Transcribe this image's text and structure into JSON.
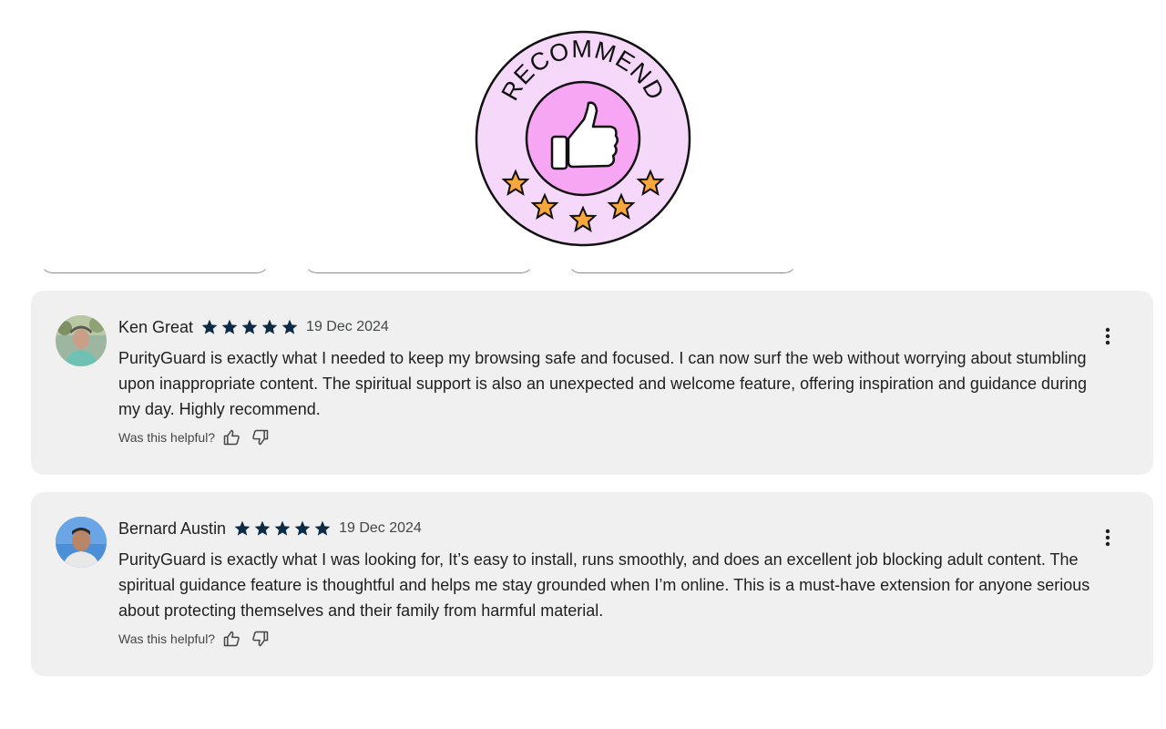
{
  "badge": {
    "text": "RECOMMEND",
    "icon": "thumbs-up-icon",
    "star_count": 5,
    "colors": {
      "outer_fill": "#f6d8fb",
      "inner_fill": "#f7a6f3",
      "star_fill": "#f8a73c",
      "outline": "#111111"
    }
  },
  "reviews": [
    {
      "name": "Ken Great",
      "rating": 5,
      "date": "19 Dec 2024",
      "text": "PurityGuard is exactly what I needed to keep my browsing safe and focused. I can now surf the web without worrying about stumbling upon inappropriate content. The spiritual support is also an unexpected and welcome feature, offering inspiration and guidance during my day. Highly recommend.",
      "helpful_label": "Was this helpful?"
    },
    {
      "name": "Bernard Austin",
      "rating": 5,
      "date": "19 Dec 2024",
      "text": "PurityGuard is exactly what I was looking for, It’s easy to install, runs smoothly, and does an excellent job blocking adult content. The spiritual guidance feature is thoughtful and helps me stay grounded when I’m online. This is a must-have extension for anyone serious about protecting themselves and their family from harmful material.",
      "helpful_label": "Was this helpful?"
    }
  ],
  "colors": {
    "card_bg": "#eff0ef",
    "star_color": "#0d2b45",
    "text": "#1f1f1f",
    "muted_text": "#444746"
  }
}
